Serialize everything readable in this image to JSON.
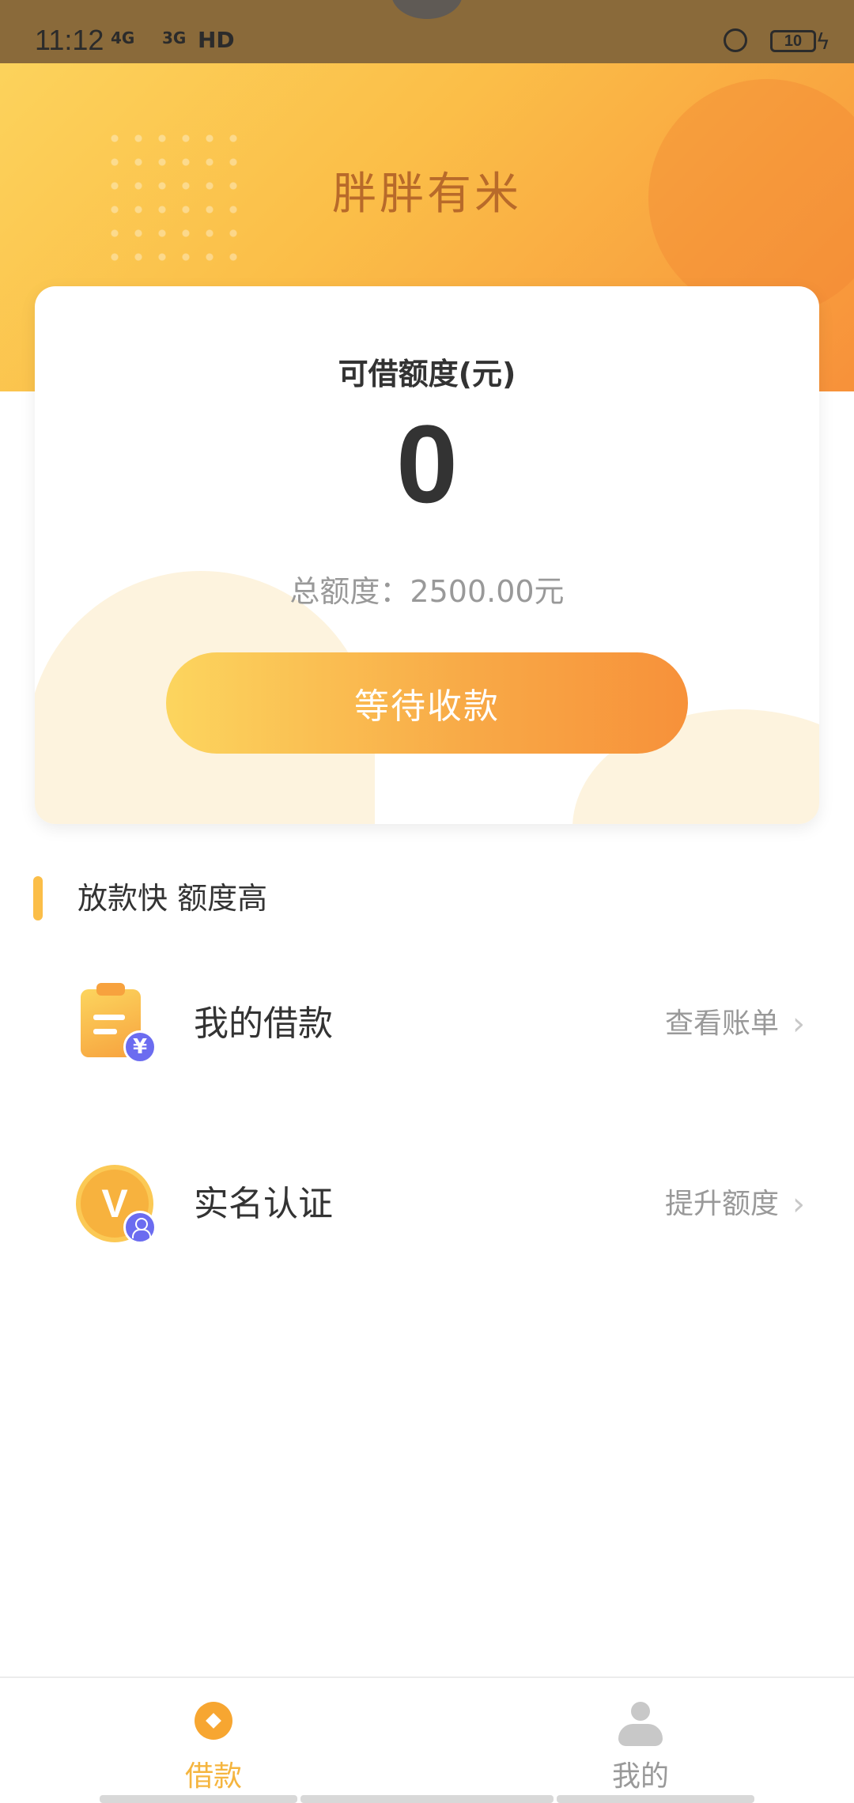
{
  "status_bar": {
    "time": "11:12",
    "signal1": "4G",
    "signal2": "3G",
    "hd": "HD",
    "battery": "10"
  },
  "header": {
    "app_title": "胖胖有米"
  },
  "card": {
    "label": "可借额度(元)",
    "amount": "0",
    "total": "总额度：2500.00元",
    "button_label": "等待收款"
  },
  "section": {
    "title": "放款快 额度高"
  },
  "rows": [
    {
      "label": "我的借款",
      "action": "查看账单",
      "icon": "clipboard-yen-icon"
    },
    {
      "label": "实名认证",
      "action": "提升额度",
      "icon": "verified-user-icon"
    }
  ],
  "bottom_nav": {
    "items": [
      {
        "label": "借款",
        "active": true,
        "icon": "loan-icon"
      },
      {
        "label": "我的",
        "active": false,
        "icon": "profile-icon"
      }
    ]
  },
  "colors": {
    "accent": "#f5b53f",
    "gradient_start": "#fcd55e",
    "gradient_end": "#f7913a"
  }
}
